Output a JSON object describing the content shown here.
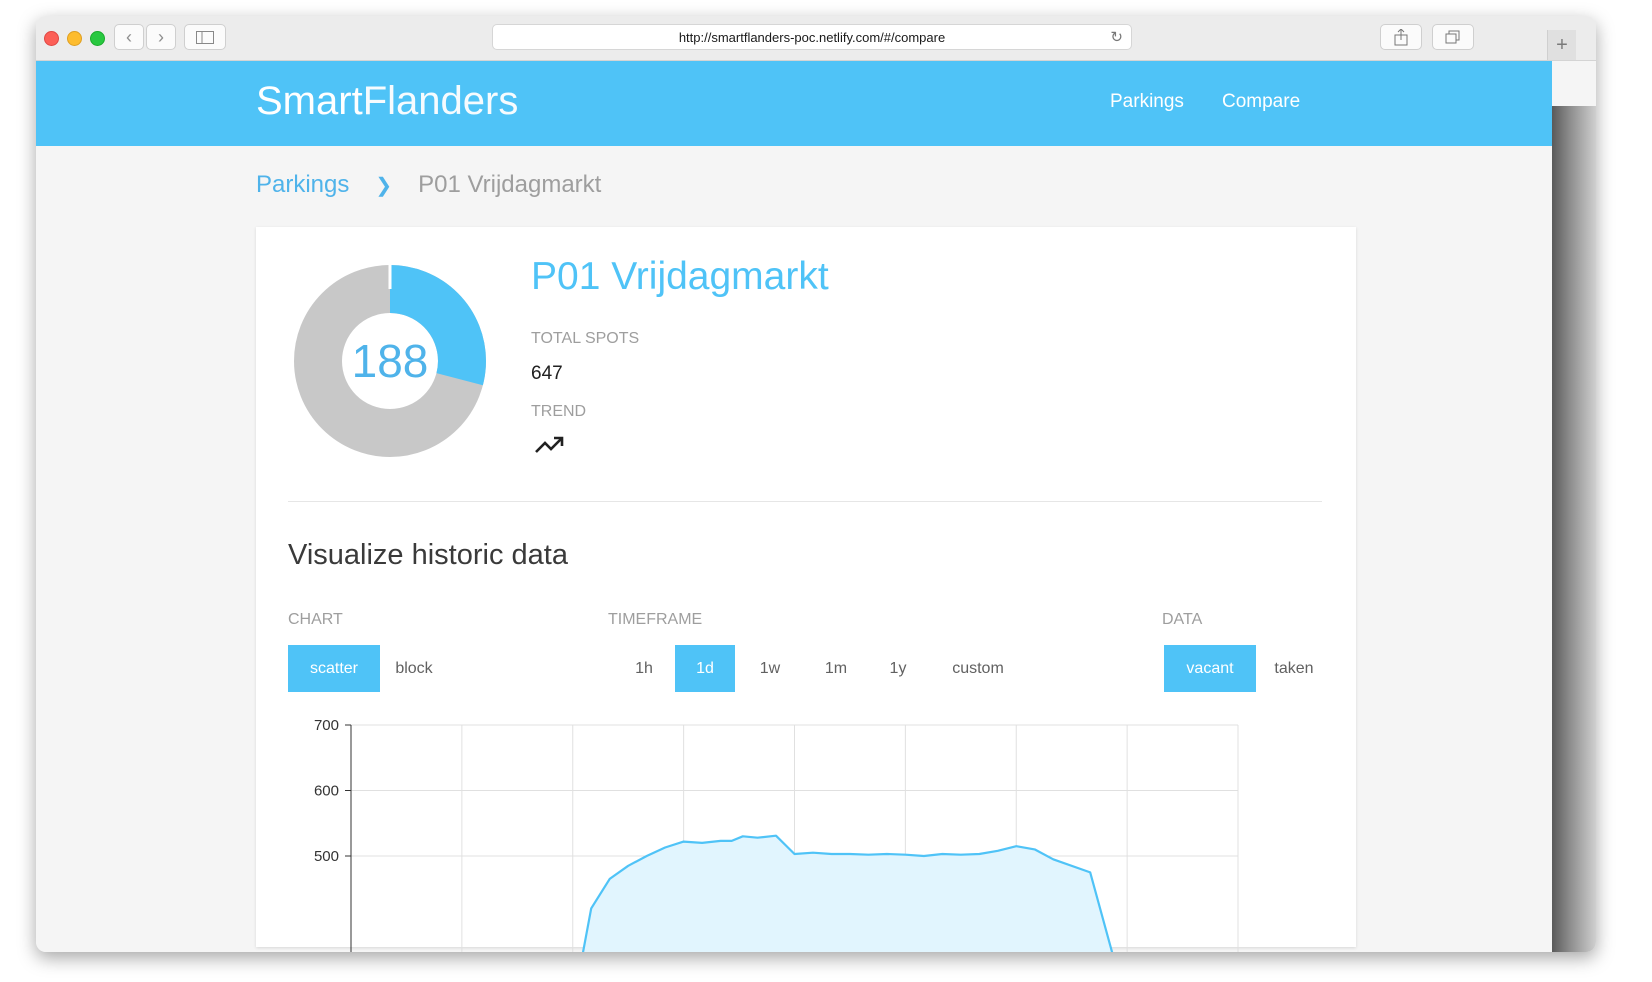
{
  "browser": {
    "url": "http://smartflanders-poc.netlify.com/#/compare"
  },
  "header": {
    "logo_primary": "Smart",
    "logo_secondary": "Flanders",
    "nav": [
      "Parkings",
      "Compare"
    ]
  },
  "breadcrumb": {
    "parent": "Parkings",
    "current": "P01 Vrijdagmarkt"
  },
  "parking": {
    "name": "P01 Vrijdagmarkt",
    "available": "188",
    "total_label": "TOTAL SPOTS",
    "total": "647",
    "trend_label": "TREND",
    "trend_icon": "trending-up-icon",
    "colors": {
      "vacant": "#4fc3f7",
      "taken": "#c8c8c8"
    }
  },
  "historic": {
    "title": "Visualize historic data",
    "chart_label": "CHART",
    "chart_options": [
      "scatter",
      "block"
    ],
    "chart_selected": "scatter",
    "timeframe_label": "TIMEFRAME",
    "timeframe_options": [
      "1h",
      "1d",
      "1w",
      "1m",
      "1y",
      "custom"
    ],
    "timeframe_selected": "1d",
    "data_label": "DATA",
    "data_options": [
      "vacant",
      "taken"
    ],
    "data_selected": "vacant"
  },
  "chart_data": {
    "type": "area",
    "y_ticks": [
      500,
      600,
      700
    ],
    "ylim": [
      420,
      700
    ],
    "xlim": [
      0,
      24
    ],
    "series": [
      {
        "x": [
          0,
          3,
          6,
          6.5,
          7,
          7.5,
          8,
          8.5,
          9,
          9.5,
          10,
          10.3,
          10.6,
          11,
          11.5,
          12,
          12.5,
          13,
          13.5,
          14,
          14.5,
          15,
          15.5,
          16,
          16.5,
          17,
          17.5,
          18,
          18.5,
          19,
          20,
          21,
          24
        ],
        "y": [
          0,
          0,
          0,
          420,
          465,
          485,
          500,
          513,
          522,
          520,
          523,
          523,
          530,
          528,
          531,
          503,
          505,
          503,
          503,
          502,
          503,
          502,
          500,
          503,
          502,
          503,
          508,
          515,
          510,
          495,
          475,
          0,
          0
        ]
      }
    ],
    "grid": true
  }
}
